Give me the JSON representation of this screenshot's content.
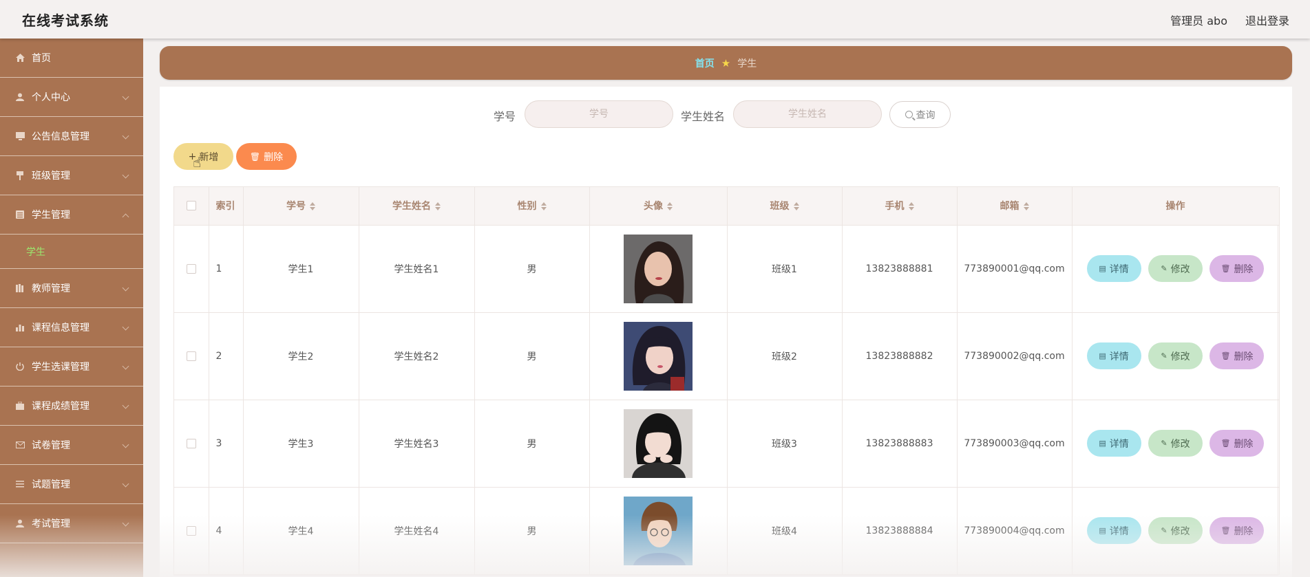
{
  "header": {
    "app_title": "在线考试系统",
    "user_label": "管理员 abo",
    "logout_label": "退出登录"
  },
  "sidebar": {
    "items": [
      {
        "label": "首页",
        "icon": "home-icon"
      },
      {
        "label": "个人中心",
        "icon": "user-icon"
      },
      {
        "label": "公告信息管理",
        "icon": "monitor-icon"
      },
      {
        "label": "班级管理",
        "icon": "brush-icon"
      },
      {
        "label": "学生管理",
        "icon": "list-icon",
        "expanded": true
      },
      {
        "label": "教师管理",
        "icon": "books-icon"
      },
      {
        "label": "课程信息管理",
        "icon": "chart-icon"
      },
      {
        "label": "学生选课管理",
        "icon": "power-icon"
      },
      {
        "label": "课程成绩管理",
        "icon": "briefcase-icon"
      },
      {
        "label": "试卷管理",
        "icon": "mail-icon"
      },
      {
        "label": "试题管理",
        "icon": "menu-icon"
      },
      {
        "label": "考试管理",
        "icon": "user-icon"
      }
    ],
    "active_sub": "学生"
  },
  "breadcrumb": {
    "home": "首页",
    "current": "学生"
  },
  "search": {
    "field1_label": "学号",
    "field1_placeholder": "学号",
    "field2_label": "学生姓名",
    "field2_placeholder": "学生姓名",
    "button_label": "查询"
  },
  "actions": {
    "add_label": "新增",
    "delete_label": "删除"
  },
  "table": {
    "headers": [
      "索引",
      "学号",
      "学生姓名",
      "性别",
      "头像",
      "班级",
      "手机",
      "邮箱",
      "操作"
    ],
    "rows": [
      {
        "index": "1",
        "xuehao": "学生1",
        "name": "学生姓名1",
        "gender": "男",
        "clazz": "班级1",
        "phone": "13823888881",
        "email": "773890001@qq.com"
      },
      {
        "index": "2",
        "xuehao": "学生2",
        "name": "学生姓名2",
        "gender": "男",
        "clazz": "班级2",
        "phone": "13823888882",
        "email": "773890002@qq.com"
      },
      {
        "index": "3",
        "xuehao": "学生3",
        "name": "学生姓名3",
        "gender": "男",
        "clazz": "班级3",
        "phone": "13823888883",
        "email": "773890003@qq.com"
      },
      {
        "index": "4",
        "xuehao": "学生4",
        "name": "学生姓名4",
        "gender": "男",
        "clazz": "班级4",
        "phone": "13823888884",
        "email": "773890004@qq.com"
      }
    ],
    "op_detail": "详情",
    "op_edit": "修改",
    "op_delete": "删除"
  },
  "colors": {
    "sidebar_bg": "#a97351",
    "breadcrumb_home": "#84e3ef",
    "active_sub": "#9be86e",
    "add_button": "#f2d98b",
    "delete_button": "#fb8a4e",
    "detail_button": "#a9e6ef",
    "edit_button": "#c7e6c8",
    "row_delete_button": "#dcb7e6"
  }
}
